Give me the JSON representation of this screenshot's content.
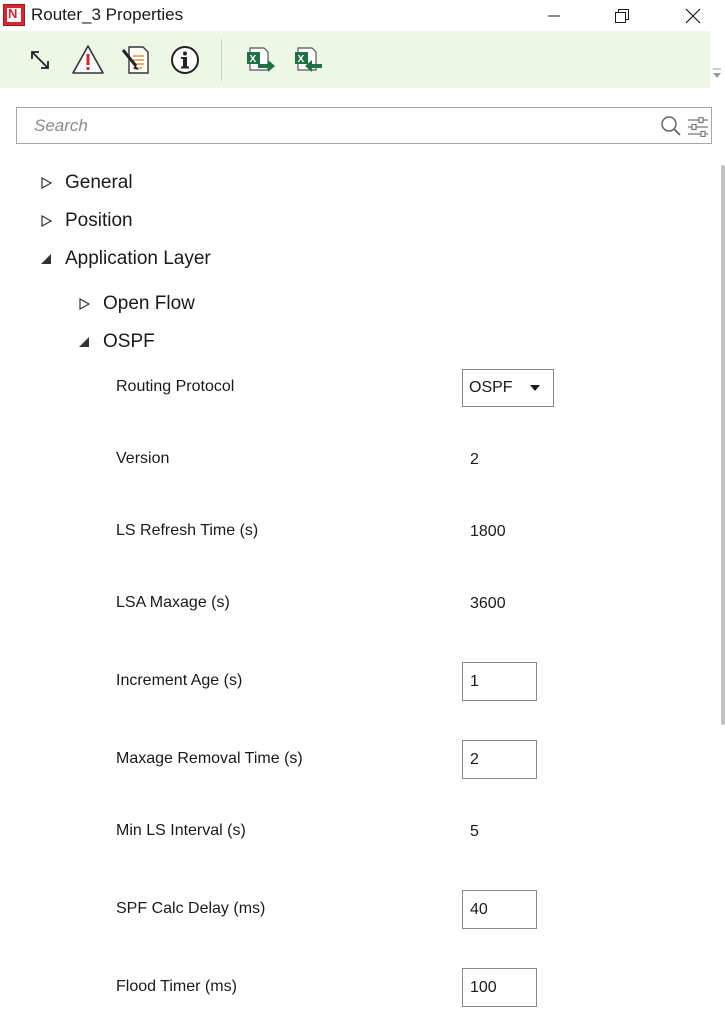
{
  "window": {
    "title": "Router_3 Properties",
    "logo_letter": "N"
  },
  "toolbar": {
    "buttons": [
      "expand-collapse-icon",
      "warning-icon",
      "edit-document-icon",
      "info-icon",
      "excel-export-icon",
      "excel-import-icon"
    ]
  },
  "search": {
    "placeholder": "Search"
  },
  "tree": {
    "general": "General",
    "position": "Position",
    "application_layer": "Application Layer",
    "open_flow": "Open Flow",
    "ospf": "OSPF"
  },
  "ospf": {
    "routing_protocol": {
      "label": "Routing Protocol",
      "value": "OSPF"
    },
    "version": {
      "label": "Version",
      "value": "2"
    },
    "ls_refresh_time": {
      "label": "LS Refresh Time (s)",
      "value": "1800"
    },
    "lsa_maxage": {
      "label": "LSA Maxage (s)",
      "value": "3600"
    },
    "increment_age": {
      "label": "Increment Age (s)",
      "value": "1"
    },
    "maxage_removal_time": {
      "label": "Maxage Removal Time (s)",
      "value": "2"
    },
    "min_ls_interval": {
      "label": "Min LS Interval (s)",
      "value": "5"
    },
    "spf_calc_delay": {
      "label": "SPF Calc Delay (ms)",
      "value": "40"
    },
    "flood_timer": {
      "label": "Flood Timer (ms)",
      "value": "100"
    }
  },
  "colors": {
    "toolbar_bg": "#eef7e6",
    "brand_red": "#d8262c",
    "excel_green": "#1e7145"
  }
}
